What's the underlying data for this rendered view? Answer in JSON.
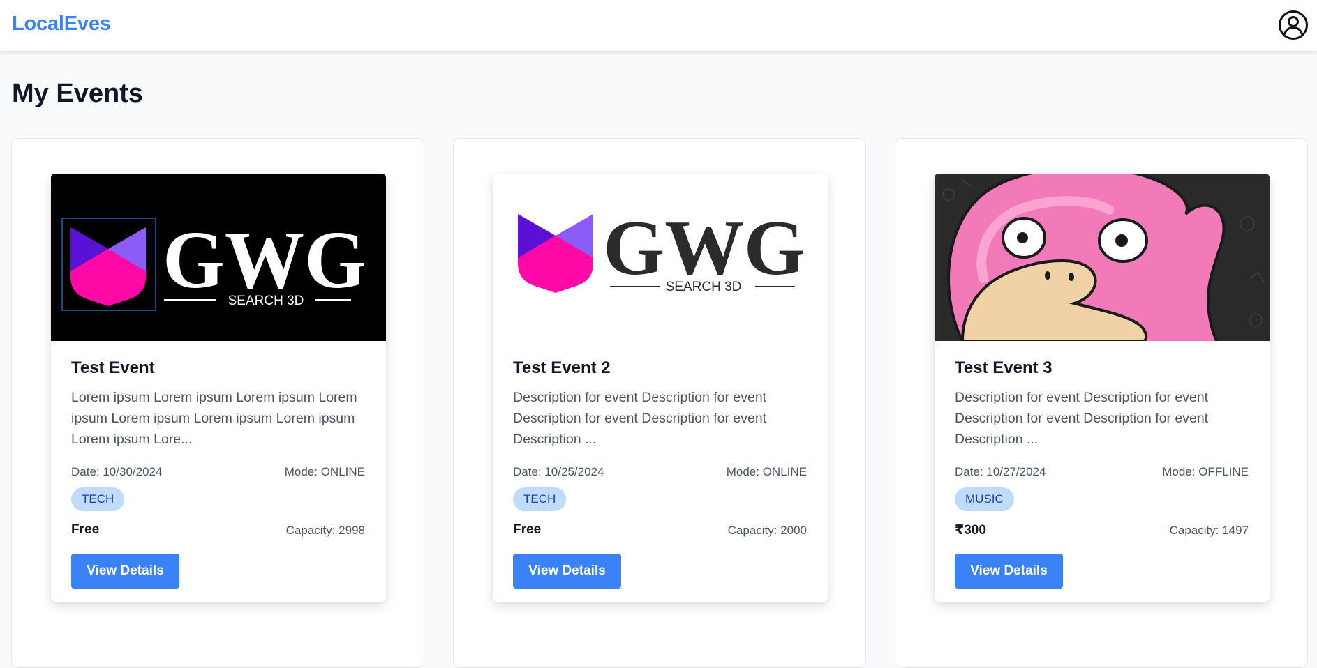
{
  "app": {
    "brand": "LocalEves"
  },
  "page": {
    "title": "My Events"
  },
  "icons": {
    "profile": "user-circle-icon"
  },
  "colors": {
    "accent": "#3b82f6",
    "badge_bg": "#bfdbfe",
    "badge_text": "#1e40af"
  },
  "logo_text": {
    "mark": "GWG",
    "sub": "SEARCH 3D"
  },
  "events": [
    {
      "title": "Test Event",
      "description": "Lorem ipsum Lorem ipsum Lorem ipsum Lorem ipsum Lorem ipsum Lorem ipsum Lorem ipsum Lorem ipsum Lore...",
      "date": "Date: 10/30/2024",
      "mode": "Mode: ONLINE",
      "category": "TECH",
      "price": "Free",
      "capacity": "Capacity: 2998",
      "button": "View Details"
    },
    {
      "title": "Test Event 2",
      "description": "Description for event Description for event Description for event Description for event Description ...",
      "date": "Date: 10/25/2024",
      "mode": "Mode: ONLINE",
      "category": "TECH",
      "price": "Free",
      "capacity": "Capacity: 2000",
      "button": "View Details"
    },
    {
      "title": "Test Event 3",
      "description": "Description for event Description for event Description for event Description for event Description ...",
      "date": "Date: 10/27/2024",
      "mode": "Mode: OFFLINE",
      "category": "MUSIC",
      "price": "₹300",
      "capacity": "Capacity: 1497",
      "button": "View Details"
    }
  ]
}
